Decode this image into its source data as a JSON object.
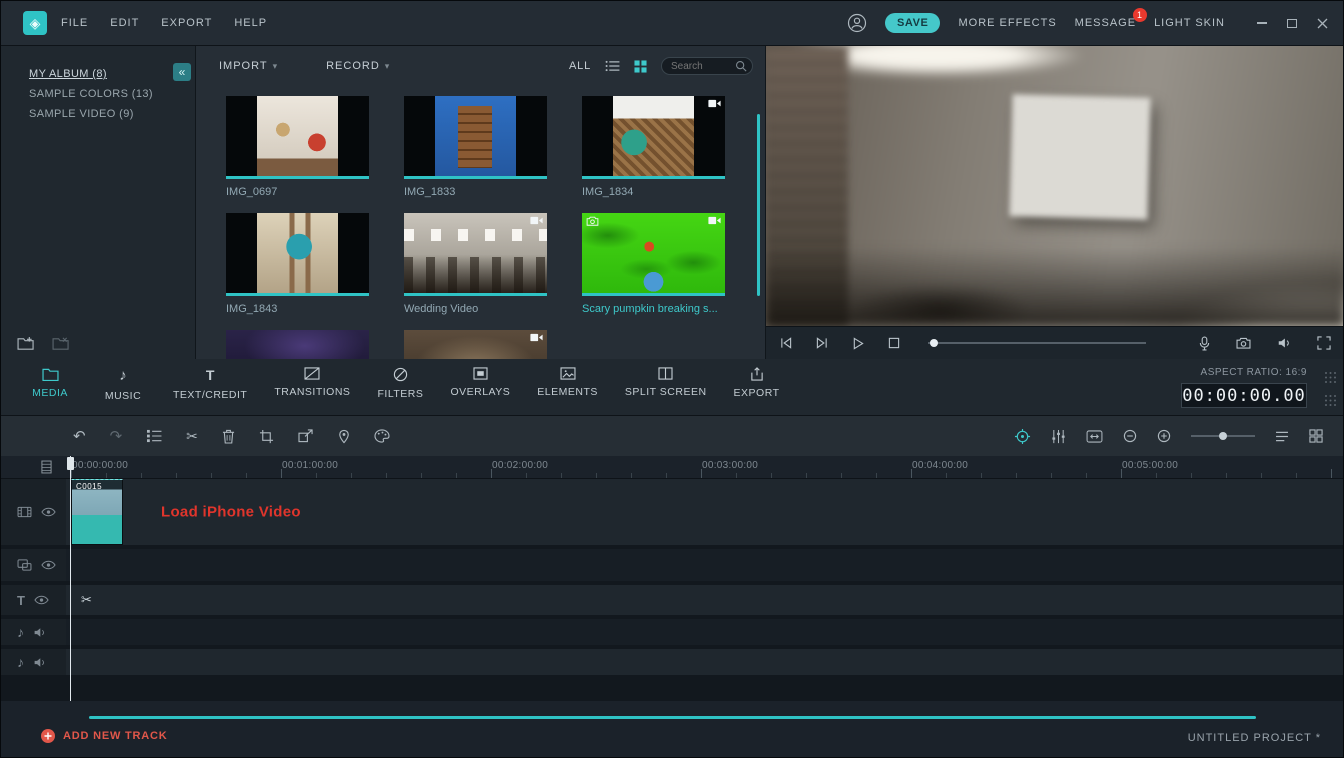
{
  "app": {
    "menus": [
      {
        "label": "FILE"
      },
      {
        "label": "EDIT"
      },
      {
        "label": "EXPORT"
      },
      {
        "label": "HELP"
      }
    ],
    "save": "SAVE",
    "more_effects": "MORE EFFECTS",
    "message": "MESSAGE",
    "message_badge": "1",
    "light_skin": "LIGHT SKIN"
  },
  "sidebar": {
    "albums": [
      {
        "label": "MY ALBUM (8)",
        "active": true
      },
      {
        "label": "SAMPLE COLORS (13)",
        "active": false
      },
      {
        "label": "SAMPLE VIDEO (9)",
        "active": false
      }
    ]
  },
  "library": {
    "import": "IMPORT",
    "record": "RECORD",
    "all": "ALL",
    "search_placeholder": "Search",
    "items": [
      {
        "name": "IMG_0697",
        "type": "photo"
      },
      {
        "name": "IMG_1833",
        "type": "photo"
      },
      {
        "name": "IMG_1834",
        "type": "video"
      },
      {
        "name": "IMG_1843",
        "type": "photo"
      },
      {
        "name": "Wedding Video",
        "type": "video"
      },
      {
        "name": "Scary pumpkin breaking s...",
        "type": "photo-video"
      },
      {
        "name": "",
        "type": "photo"
      },
      {
        "name": "",
        "type": "video"
      }
    ]
  },
  "tabs": {
    "items": [
      {
        "label": "MEDIA",
        "active": true
      },
      {
        "label": "MUSIC",
        "active": false
      },
      {
        "label": "TEXT/CREDIT",
        "active": false
      },
      {
        "label": "TRANSITIONS",
        "active": false
      },
      {
        "label": "FILTERS",
        "active": false
      },
      {
        "label": "OVERLAYS",
        "active": false
      },
      {
        "label": "ELEMENTS",
        "active": false
      },
      {
        "label": "SPLIT SCREEN",
        "active": false
      },
      {
        "label": "EXPORT",
        "active": false
      }
    ],
    "aspect_ratio": "ASPECT RATIO: 16:9",
    "timecode": "00:00:00.00"
  },
  "timeline": {
    "ruler": [
      "00:00:00:00",
      "00:01:00:00",
      "00:02:00:00",
      "00:03:00:00",
      "00:04:00:00",
      "00:05:00:00"
    ],
    "clip_name": "C0015",
    "annotation": "Load iPhone Video",
    "add_new_track": "ADD NEW TRACK",
    "project_name": "UNTITLED PROJECT *"
  },
  "colors": {
    "accent_teal": "#3ec9cb",
    "annotation_red": "#e0352c",
    "add_track_red": "#e2574a",
    "badge_red": "#e8392e"
  },
  "icons": {
    "logo": "◈",
    "chevron": "▾",
    "collapse": "«",
    "undo": "↶",
    "redo": "↷",
    "scissors": "✂",
    "music_note": "♪",
    "text_track": "T"
  }
}
